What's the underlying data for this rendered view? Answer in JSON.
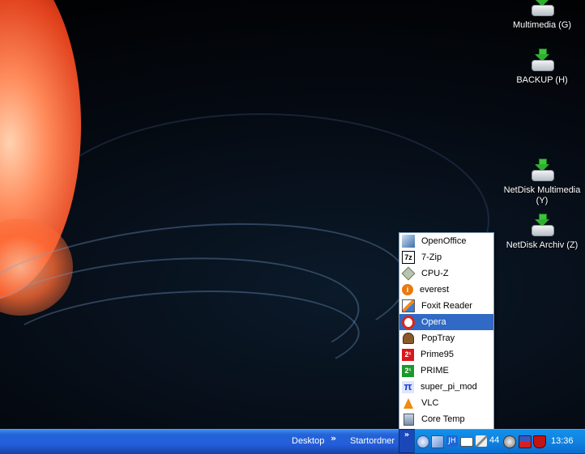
{
  "desktop_icons": [
    {
      "label": "Multimedia (G)",
      "icon": "network-drive-icon"
    },
    {
      "label": "BACKUP (H)",
      "icon": "network-drive-icon"
    },
    {
      "label": "NetDisk Multimedia (Y)",
      "icon": "network-drive-icon"
    },
    {
      "label": "NetDisk Archiv (Z)",
      "icon": "network-drive-icon"
    }
  ],
  "menu": {
    "items": [
      {
        "label": "OpenOffice",
        "icon": "openoffice-icon"
      },
      {
        "label": "7-Zip",
        "icon": "7zip-icon",
        "glyph": "7z"
      },
      {
        "label": "CPU-Z",
        "icon": "cpuz-icon"
      },
      {
        "label": "everest",
        "icon": "everest-icon",
        "glyph": "i"
      },
      {
        "label": "Foxit Reader",
        "icon": "foxit-icon"
      },
      {
        "label": "Opera",
        "icon": "opera-icon",
        "selected": true
      },
      {
        "label": "PopTray",
        "icon": "poptray-icon"
      },
      {
        "label": "Prime95",
        "icon": "prime95-icon",
        "glyph": "2¹"
      },
      {
        "label": "PRIME",
        "icon": "prime-icon",
        "glyph": "2¹"
      },
      {
        "label": "super_pi_mod",
        "icon": "superpi-icon",
        "glyph": "π"
      },
      {
        "label": "VLC",
        "icon": "vlc-icon"
      },
      {
        "label": "Core Temp",
        "icon": "coretemp-icon"
      }
    ]
  },
  "taskbar": {
    "desktop_label": "Desktop",
    "startordner_label": "Startordner",
    "chevron": "»",
    "tray_number": "44",
    "clock": "13:36",
    "tray_icons": [
      "back-icon",
      "network-icon",
      "keyboard-language-icon",
      "mail-icon",
      "pen-icon",
      "speaker-icon",
      "monitor-icon",
      "shield-icon"
    ]
  },
  "colors": {
    "selection": "#316ac5",
    "taskbar": "#245edb",
    "tray": "#0f83e1"
  }
}
